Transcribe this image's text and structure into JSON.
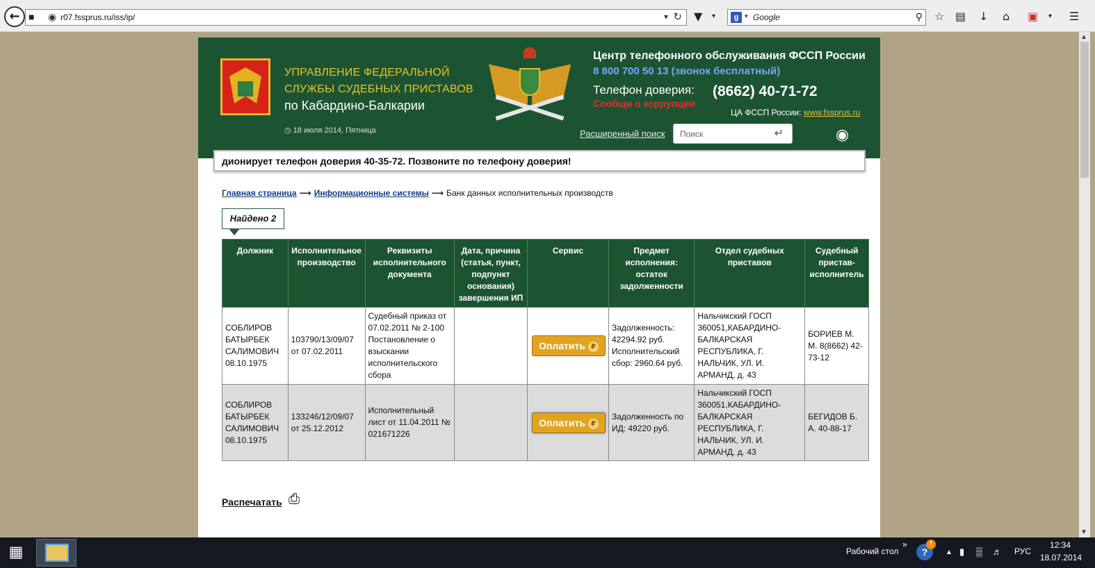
{
  "browser": {
    "url": "r07.fssprus.ru/iss/ip/",
    "search_engine": "Google"
  },
  "header": {
    "org_line1": "УПРАВЛЕНИЕ ФЕДЕРАЛЬНОЙ",
    "org_line2": "СЛУЖБЫ СУДЕБНЫХ ПРИСТАВОВ",
    "org_line3": "по Кабардино-Балкарии",
    "date": "18 июля 2014, Пятница",
    "call_center_title": "Центр телефонного обслуживания ФССП России",
    "call_center_phone": "8 800 700 50 13 (звонок бесплатный)",
    "trust_label": "Телефон доверия:",
    "trust_phone": "(8662) 40-71-72",
    "corruption_link": "Сообщи о коррупции",
    "central_label": "ЦА ФССП России:",
    "central_link": "www.fssprus.ru",
    "advanced_search": "Расширенный поиск",
    "search_placeholder": "Поиск",
    "colors": {
      "header_bg": "#1c5432",
      "gold": "#e8c227",
      "blue": "#6fa8ff",
      "red": "#e0302d"
    }
  },
  "ticker": "дионирует телефон доверия 40-35-72. Позвоните по телефону доверия!",
  "breadcrumb": {
    "home": "Главная страница",
    "systems": "Информационные системы",
    "current": "Банк данных исполнительных производств"
  },
  "found_label": "Найдено 2",
  "table": {
    "headers": [
      "Должник",
      "Исполнительное производство",
      "Реквизиты исполнительного документа",
      "Дата, причина (статья, пункт, подпункт основания) завершения ИП",
      "Сервис",
      "Предмет исполнения: остаток задолженности",
      "Отдел судебных приставов",
      "Судебный пристав-исполнитель"
    ],
    "pay_label": "Оплатить",
    "rows": [
      {
        "debtor": "СОБЛИРОВ БАТЫРБЕК САЛИМОВИЧ 08.10.1975",
        "proceeding": "103790/13/09/07 от 07.02.2011",
        "document": "Судебный приказ от 07.02.2011 № 2-100 Постановление о взыскании исполнительского сбора",
        "end_date": "",
        "subject": "Задолженность: 42294.92 руб. Исполнительский сбор: 2960.64 руб.",
        "department": "Нальчикский ГОСП 360051,КАБАРДИНО-БАЛКАРСКАЯ РЕСПУБЛИКА, Г. НАЛЬЧИК, УЛ. И. АРМАНД, д. 43",
        "bailiff": "БОРИЕВ М. М. 8(8662) 42-73-12"
      },
      {
        "debtor": "СОБЛИРОВ БАТЫРБЕК САЛИМОВИЧ 08.10.1975",
        "proceeding": "133246/12/09/07 от 25.12.2012",
        "document": "Исполнительный лист от 11.04.2011 № 021671226",
        "end_date": "",
        "subject": "Задолженность по ИД: 49220 руб.",
        "department": "Нальчикский ГОСП 360051,КАБАРДИНО-БАЛКАРСКАЯ РЕСПУБЛИКА, Г. НАЛЬЧИК, УЛ. И. АРМАНД, д. 43",
        "bailiff": "БЕГИДОВ Б. А. 40-88-17"
      }
    ]
  },
  "print_label": "Распечатать",
  "taskbar": {
    "desktop_label": "Рабочий стол",
    "language": "РУС",
    "time": "12:34",
    "date": "18.07.2014"
  }
}
